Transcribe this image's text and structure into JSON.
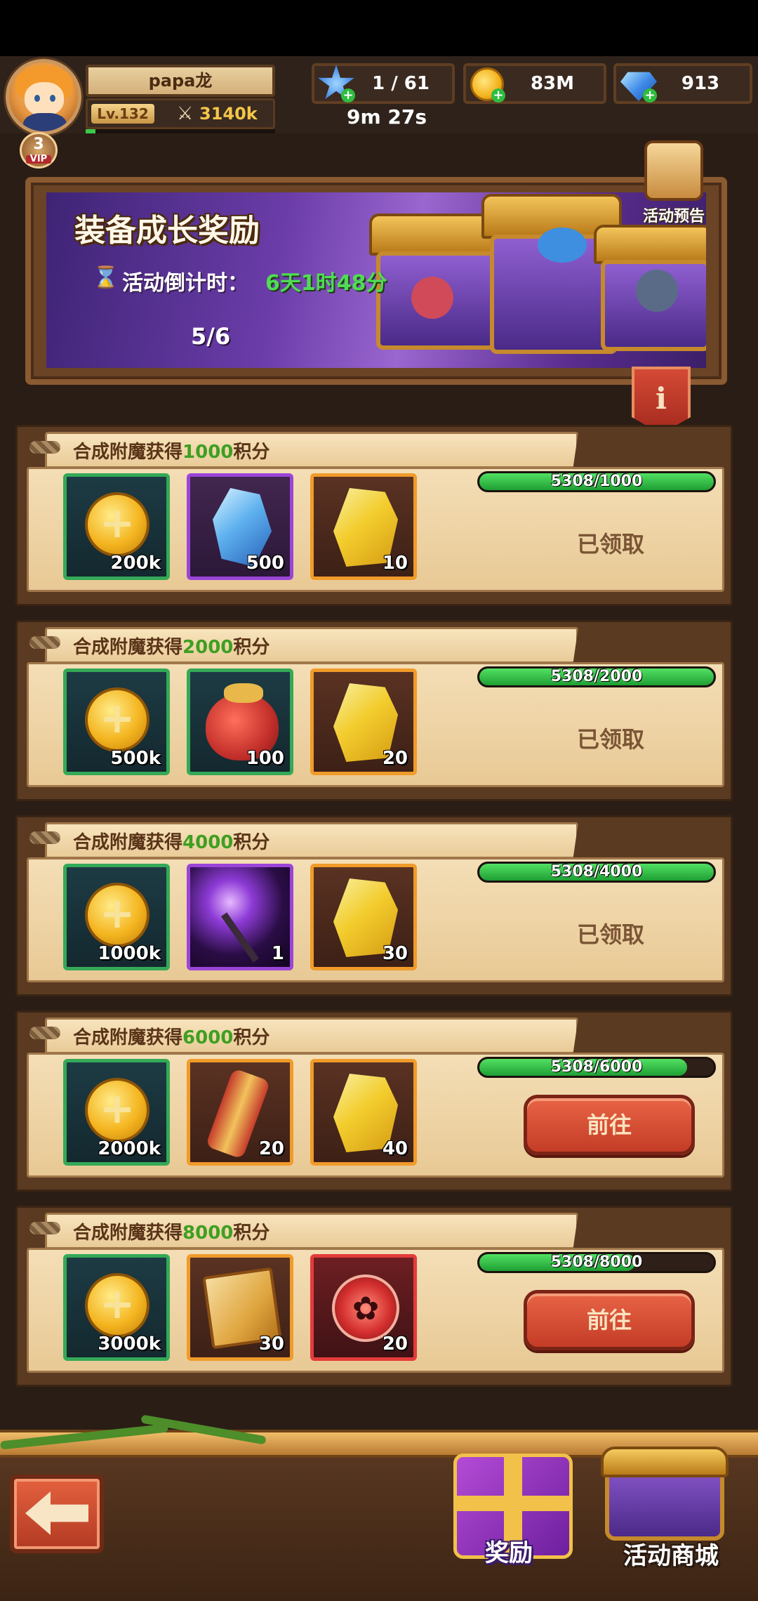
{
  "player": {
    "name": "papa龙",
    "level": "Lv.132",
    "power": "3140k",
    "vip_level": "3",
    "vip_label": "VIP"
  },
  "resources": {
    "stamina": "1 / 61",
    "stamina_timer": "9m 27s",
    "gold": "83M",
    "gems": "913"
  },
  "banner": {
    "title": "装备成长奖励",
    "countdown_label": "活动倒计时：",
    "countdown_value": "6天1时48分",
    "progress": "5/6",
    "preview_label": "活动预告",
    "info_label": "i"
  },
  "tasks": [
    {
      "title_prefix": "合成附魔获得",
      "title_points": "1000",
      "title_suffix": "积分",
      "progress_text": "5308/1000",
      "progress_fraction": 1.0,
      "status": "claimed",
      "status_label": "已领取",
      "rewards": [
        {
          "icon": "gold-coin",
          "count": "200k",
          "rarity": "green"
        },
        {
          "icon": "ice-crystal",
          "count": "500",
          "rarity": "purple"
        },
        {
          "icon": "gold-crystal",
          "count": "10",
          "rarity": "orange"
        }
      ]
    },
    {
      "title_prefix": "合成附魔获得",
      "title_points": "2000",
      "title_suffix": "积分",
      "progress_text": "5308/2000",
      "progress_fraction": 1.0,
      "status": "claimed",
      "status_label": "已领取",
      "rewards": [
        {
          "icon": "gold-coin",
          "count": "500k",
          "rarity": "green"
        },
        {
          "icon": "red-bag",
          "count": "100",
          "rarity": "green"
        },
        {
          "icon": "gold-crystal",
          "count": "20",
          "rarity": "orange"
        }
      ]
    },
    {
      "title_prefix": "合成附魔获得",
      "title_points": "4000",
      "title_suffix": "积分",
      "progress_text": "5308/4000",
      "progress_fraction": 1.0,
      "status": "claimed",
      "status_label": "已领取",
      "rewards": [
        {
          "icon": "gold-coin",
          "count": "1000k",
          "rarity": "green"
        },
        {
          "icon": "lightning-staff",
          "count": "1",
          "rarity": "purple"
        },
        {
          "icon": "gold-crystal",
          "count": "30",
          "rarity": "orange"
        }
      ]
    },
    {
      "title_prefix": "合成附魔获得",
      "title_points": "6000",
      "title_suffix": "积分",
      "progress_text": "5308/6000",
      "progress_fraction": 0.885,
      "status": "go",
      "status_label": "前往",
      "rewards": [
        {
          "icon": "gold-coin",
          "count": "2000k",
          "rarity": "green"
        },
        {
          "icon": "scroll",
          "count": "20",
          "rarity": "orange"
        },
        {
          "icon": "gold-crystal",
          "count": "40",
          "rarity": "orange"
        }
      ]
    },
    {
      "title_prefix": "合成附魔获得",
      "title_points": "8000",
      "title_suffix": "积分",
      "progress_text": "5308/8000",
      "progress_fraction": 0.664,
      "status": "go",
      "status_label": "前往",
      "rewards": [
        {
          "icon": "gold-coin",
          "count": "3000k",
          "rarity": "green"
        },
        {
          "icon": "spell-book",
          "count": "30",
          "rarity": "orange"
        },
        {
          "icon": "paw-token",
          "count": "20",
          "rarity": "red"
        }
      ]
    }
  ],
  "bottom_nav": {
    "back_label": "",
    "reward_label": "奖励",
    "shop_label": "活动商城"
  },
  "colors": {
    "accent_green": "#3f9f22",
    "progress_green": "#39c94c",
    "go_button": "#d5492f",
    "paper": "#f0d7a8"
  }
}
